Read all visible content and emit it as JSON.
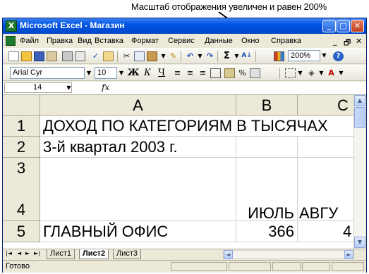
{
  "annotation": {
    "text": "Масштаб отображения увеличен и равен 200%"
  },
  "window": {
    "title": "Microsoft Excel - Магазин"
  },
  "window_controls": {
    "minimize": "_",
    "maximize": "□",
    "close": "✕"
  },
  "menu": {
    "items": [
      "Файл",
      "Правка",
      "Вид",
      "Вставка",
      "Формат",
      "Сервис",
      "Данные",
      "Окно",
      "Справка"
    ],
    "doc_controls": {
      "minimize": "_",
      "restore": "🗗",
      "close": "✕"
    }
  },
  "standard_toolbar": {
    "sum_symbol": "Σ",
    "zoom": "200%",
    "icons": [
      "new-icon",
      "open-icon",
      "save-icon",
      "permission-icon",
      "print-icon",
      "print-preview-icon",
      "spelling-icon",
      "research-icon",
      "cut-icon",
      "copy-icon",
      "paste-icon",
      "format-painter-icon",
      "undo-icon",
      "redo-icon",
      "autosum-icon",
      "sort-ascending-icon",
      "chart-wizard-icon",
      "zoom-icon",
      "help-icon"
    ]
  },
  "formatting_toolbar": {
    "font": "Arial Cyr",
    "size": "10",
    "bold": "Ж",
    "italic": "К",
    "underline": "Ч",
    "percent": "%"
  },
  "formula_bar": {
    "name_box": "14",
    "fx": "fx"
  },
  "sheet": {
    "columns": [
      "A",
      "B",
      "C"
    ],
    "rows": [
      {
        "num": "1",
        "a": "ДОХОД ПО КАТЕГОРИЯМ В ТЫСЯЧАХ",
        "b": "",
        "c": ""
      },
      {
        "num": "2",
        "a": "3-й квартал 2003 г.",
        "b": "",
        "c": ""
      },
      {
        "num": "3",
        "a": "",
        "b": "",
        "c": ""
      },
      {
        "num": "4",
        "a": "",
        "b": "ИЮЛЬ",
        "c": "АВГУ"
      },
      {
        "num": "5",
        "a": "ГЛАВНЫЙ ОФИС",
        "b": "366",
        "c": "4"
      }
    ]
  },
  "sheet_tabs": [
    "Лист1",
    "Лист2",
    "Лист3"
  ],
  "active_tab": "Лист2",
  "status": {
    "text": "Готово"
  }
}
